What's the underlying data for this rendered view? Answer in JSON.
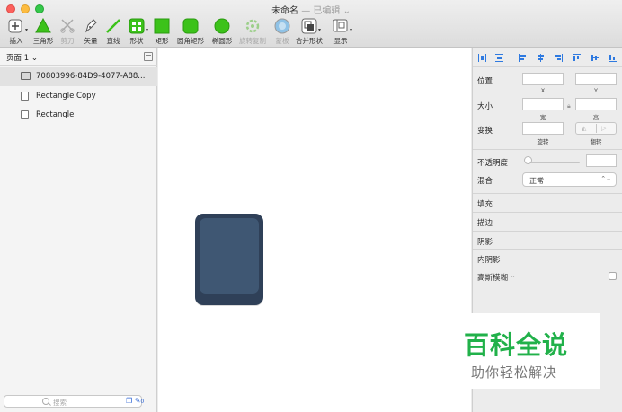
{
  "window": {
    "title": "未命名",
    "title_separator": "—",
    "status": "已编辑",
    "status_arrow": "⌄"
  },
  "toolbar": {
    "tools": [
      {
        "id": "insert",
        "label": "插入",
        "icon": "plus-icon"
      },
      {
        "id": "triangle",
        "label": "三角形",
        "icon": "triangle-icon"
      },
      {
        "id": "scissors",
        "label": "剪刀",
        "icon": "scissors-icon"
      },
      {
        "id": "vector",
        "label": "矢量",
        "icon": "pen-icon"
      },
      {
        "id": "line",
        "label": "直线",
        "icon": "line-icon"
      },
      {
        "id": "shape",
        "label": "形状",
        "icon": "shapes-icon"
      },
      {
        "id": "rect",
        "label": "矩形",
        "icon": "rectangle-icon"
      },
      {
        "id": "rounded-rect",
        "label": "圆角矩形",
        "icon": "rounded-rectangle-icon"
      },
      {
        "id": "ellipse",
        "label": "椭圆形",
        "icon": "ellipse-icon"
      },
      {
        "id": "rotate-copy",
        "label": "旋转复制",
        "icon": "rotate-copy-icon"
      },
      {
        "id": "mask",
        "label": "蒙板",
        "icon": "mask-icon"
      },
      {
        "id": "combine",
        "label": "合并形状",
        "icon": "combine-icon"
      },
      {
        "id": "view",
        "label": "显示",
        "icon": "view-icon"
      }
    ],
    "accent_green": "#3cc21a"
  },
  "pages": {
    "current": "页面 1",
    "caret": "⌄"
  },
  "layers": [
    {
      "name": "70803996-84D9-4077-A88...",
      "icon": "image-icon"
    },
    {
      "name": "Rectangle Copy",
      "icon": "rectangle-layer-icon"
    },
    {
      "name": "Rectangle",
      "icon": "rectangle-layer-icon"
    }
  ],
  "left_bottom": {
    "search_placeholder": "搜索",
    "count": "0"
  },
  "canvas": {
    "shape_outer_color": "#2f4058",
    "shape_inner_color": "#3f5773"
  },
  "inspector": {
    "position_label": "位置",
    "x_label": "X",
    "y_label": "Y",
    "size_label": "大小",
    "width_label": "宽",
    "height_label": "高",
    "transform_label": "变换",
    "rotate_label": "旋转",
    "flip_label": "翻转",
    "opacity_label": "不透明度",
    "blend_label": "混合",
    "blend_value": "正常",
    "fill_label": "填充",
    "border_label": "描边",
    "shadow_label": "阴影",
    "inner_shadow_label": "内阴影",
    "blur_label": "高斯模糊",
    "blur_caret": "⌃"
  },
  "watermark": {
    "title": "百科全说",
    "subtitle": "助你轻松解决"
  }
}
